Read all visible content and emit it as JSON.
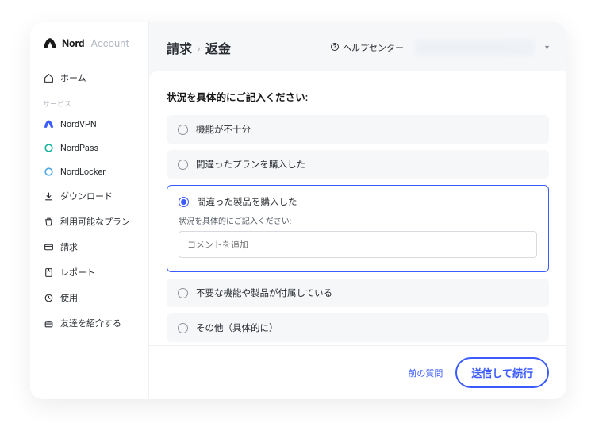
{
  "brand": {
    "name": "Nord",
    "sub": "Account"
  },
  "sidebar": {
    "home": "ホーム",
    "section_services": "サービス",
    "items": {
      "nordvpn": "NordVPN",
      "nordpass": "NordPass",
      "nordlocker": "NordLocker",
      "downloads": "ダウンロード",
      "plans": "利用可能なプラン",
      "billing": "請求",
      "reports": "レポート",
      "usage": "使用",
      "refer": "友達を紹介する"
    }
  },
  "breadcrumb": {
    "a": "請求",
    "b": "返金"
  },
  "topbar": {
    "help": "ヘルプセンター"
  },
  "form": {
    "title": "状況を具体的にご記入ください:",
    "options": {
      "insufficient": "機能が不十分",
      "wrong_plan": "間違ったプランを購入した",
      "wrong_product": "間違った製品を購入した",
      "unwanted": "不要な機能や製品が付属している",
      "other": "その他（具体的に）"
    },
    "sub_prompt": "状況を具体的にご記入ください:",
    "comment_placeholder": "コメントを追加"
  },
  "footer": {
    "prev": "前の質問",
    "submit": "送信して続行"
  }
}
